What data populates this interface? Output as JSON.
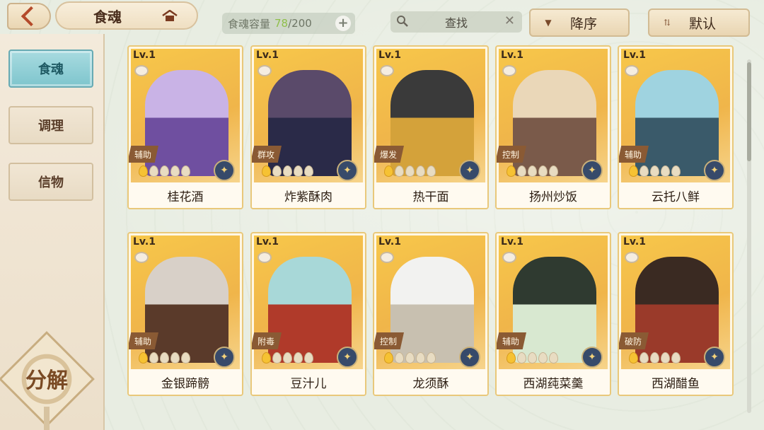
{
  "header": {
    "title": "食魂",
    "capacity_label": "食魂容量",
    "capacity_current": "78",
    "capacity_max": "/200",
    "search_label": "查找",
    "sort_order_label": "降序",
    "sort_mode_label": "默认"
  },
  "sidebar": {
    "items": [
      {
        "label": "食魂",
        "active": true
      },
      {
        "label": "调理",
        "active": false
      },
      {
        "label": "信物",
        "active": false
      }
    ],
    "decompose_label": "分解"
  },
  "cards": [
    {
      "level": "Lv.1",
      "role": "辅助",
      "name": "桂花酒",
      "stars_on": 1,
      "stars_total": 5
    },
    {
      "level": "Lv.1",
      "role": "群攻",
      "name": "炸紫酥肉",
      "stars_on": 1,
      "stars_total": 5
    },
    {
      "level": "Lv.1",
      "role": "爆发",
      "name": "热干面",
      "stars_on": 1,
      "stars_total": 5
    },
    {
      "level": "Lv.1",
      "role": "控制",
      "name": "扬州炒饭",
      "stars_on": 1,
      "stars_total": 5
    },
    {
      "level": "Lv.1",
      "role": "辅助",
      "name": "云托八鲜",
      "stars_on": 1,
      "stars_total": 5
    },
    {
      "level": "Lv.1",
      "role": "辅助",
      "name": "金银蹄髈",
      "stars_on": 1,
      "stars_total": 5
    },
    {
      "level": "Lv.1",
      "role": "附毒",
      "name": "豆汁儿",
      "stars_on": 1,
      "stars_total": 5
    },
    {
      "level": "Lv.1",
      "role": "控制",
      "name": "龙须酥",
      "stars_on": 1,
      "stars_total": 5
    },
    {
      "level": "Lv.1",
      "role": "辅助",
      "name": "西湖莼菜羹",
      "stars_on": 1,
      "stars_total": 5
    },
    {
      "level": "Lv.1",
      "role": "破防",
      "name": "西湖醋鱼",
      "stars_on": 1,
      "stars_total": 5
    }
  ],
  "colors": {
    "accent_teal": "#7ec5cd",
    "card_border": "#e9c87a",
    "capacity_current": "#8fbf4a"
  }
}
